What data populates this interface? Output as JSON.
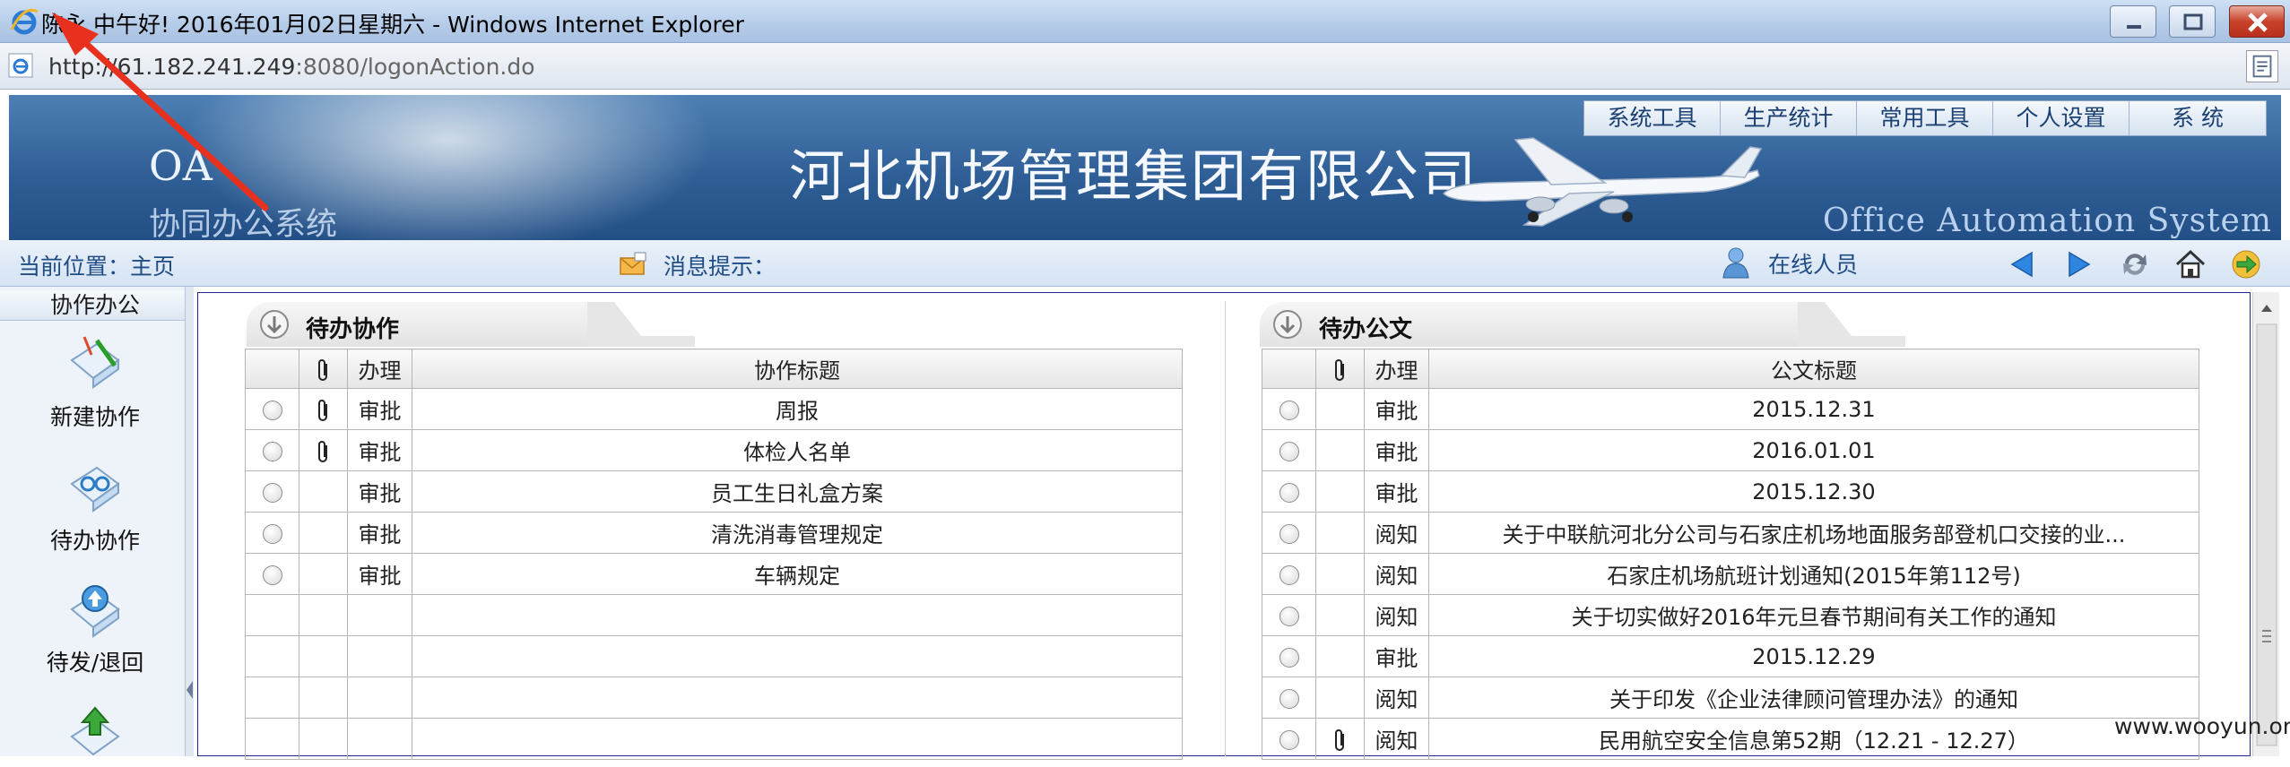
{
  "window": {
    "title": "陈永 中午好! 2016年01月02日星期六 - Windows Internet Explorer",
    "address_prefix": "http://",
    "address_host": "61.182.241.249",
    "address_rest": ":8080/logonAction.do"
  },
  "banner": {
    "oa": "OA",
    "subtitle": "协同办公系统",
    "company": "河北机场管理集团有限公司",
    "english": "Office Automation System",
    "menu": [
      "系统工具",
      "生产统计",
      "常用工具",
      "个人设置",
      "系 统"
    ]
  },
  "locbar": {
    "location": "当前位置：主页",
    "message": "消息提示：",
    "online": "在线人员"
  },
  "sidebar": {
    "header": "协作办公",
    "items": [
      {
        "label": "新建协作",
        "icon": "new-collab-icon"
      },
      {
        "label": "待办协作",
        "icon": "pending-collab-icon"
      },
      {
        "label": "待发/退回",
        "icon": "send-return-icon"
      },
      {
        "label": "",
        "icon": "upload-icon"
      }
    ]
  },
  "collab": {
    "title": "待办协作",
    "columns": [
      "",
      "",
      "办理",
      "协作标题"
    ],
    "rows": [
      {
        "attach": true,
        "action": "审批",
        "subject": "周报"
      },
      {
        "attach": true,
        "action": "审批",
        "subject": "体检人名单"
      },
      {
        "attach": false,
        "action": "审批",
        "subject": "员工生日礼盒方案"
      },
      {
        "attach": false,
        "action": "审批",
        "subject": "清洗消毒管理规定"
      },
      {
        "attach": false,
        "action": "审批",
        "subject": "车辆规定"
      }
    ]
  },
  "docs": {
    "title": "待办公文",
    "columns": [
      "",
      "",
      "办理",
      "公文标题"
    ],
    "rows": [
      {
        "attach": false,
        "action": "审批",
        "subject": "2015.12.31"
      },
      {
        "attach": false,
        "action": "审批",
        "subject": "2016.01.01"
      },
      {
        "attach": false,
        "action": "审批",
        "subject": "2015.12.30"
      },
      {
        "attach": false,
        "action": "阅知",
        "subject": "关于中联航河北分公司与石家庄机场地面服务部登机口交接的业..."
      },
      {
        "attach": false,
        "action": "阅知",
        "subject": "石家庄机场航班计划通知(2015年第112号)"
      },
      {
        "attach": false,
        "action": "阅知",
        "subject": "关于切实做好2016年元旦春节期间有关工作的通知"
      },
      {
        "attach": false,
        "action": "审批",
        "subject": "2015.12.29"
      },
      {
        "attach": false,
        "action": "阅知",
        "subject": "关于印发《企业法律顾问管理办法》的通知"
      },
      {
        "attach": true,
        "action": "阅知",
        "subject": "民用航空安全信息第52期（12.21 - 12.27）"
      }
    ]
  },
  "watermark": "www.wooyun.org",
  "colors": {
    "banner": "#2f5f96",
    "accent": "#1f4c84",
    "arrow": "#e8301f",
    "frame_border": "#1a2a8f"
  }
}
